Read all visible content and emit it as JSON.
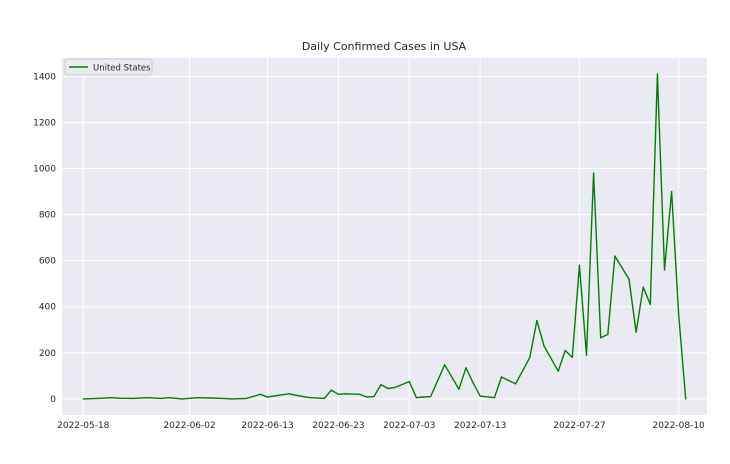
{
  "chart_data": {
    "type": "line",
    "title": "Daily Confirmed Cases in USA",
    "xlabel": "",
    "ylabel": "",
    "x_ticks": [
      "2022-05-18",
      "2022-06-02",
      "2022-06-13",
      "2022-06-23",
      "2022-07-03",
      "2022-07-13",
      "2022-07-27",
      "2022-08-10"
    ],
    "y_ticks": [
      0,
      200,
      400,
      600,
      800,
      1000,
      1200,
      1400
    ],
    "ylim": [
      -70,
      1480
    ],
    "xlim": [
      "2022-05-15",
      "2022-08-14"
    ],
    "grid": true,
    "legend": {
      "position": "top-left"
    },
    "colors": {
      "background": "#eaeaf2",
      "grid": "#ffffff",
      "line": "#008000"
    },
    "series": [
      {
        "name": "United States",
        "x": [
          "2022-05-18",
          "2022-05-20",
          "2022-05-22",
          "2022-05-23",
          "2022-05-25",
          "2022-05-27",
          "2022-05-29",
          "2022-05-30",
          "2022-06-01",
          "2022-06-03",
          "2022-06-05",
          "2022-06-06",
          "2022-06-08",
          "2022-06-10",
          "2022-06-12",
          "2022-06-13",
          "2022-06-14",
          "2022-06-16",
          "2022-06-18",
          "2022-06-19",
          "2022-06-21",
          "2022-06-22",
          "2022-06-23",
          "2022-06-24",
          "2022-06-26",
          "2022-06-27",
          "2022-06-28",
          "2022-06-29",
          "2022-06-30",
          "2022-07-01",
          "2022-07-03",
          "2022-07-04",
          "2022-07-05",
          "2022-07-06",
          "2022-07-08",
          "2022-07-10",
          "2022-07-11",
          "2022-07-12",
          "2022-07-13",
          "2022-07-15",
          "2022-07-16",
          "2022-07-18",
          "2022-07-20",
          "2022-07-21",
          "2022-07-22",
          "2022-07-24",
          "2022-07-25",
          "2022-07-26",
          "2022-07-27",
          "2022-07-28",
          "2022-07-29",
          "2022-07-30",
          "2022-07-31",
          "2022-08-01",
          "2022-08-03",
          "2022-08-04",
          "2022-08-05",
          "2022-08-06",
          "2022-08-07",
          "2022-08-08",
          "2022-08-09",
          "2022-08-10",
          "2022-08-11"
        ],
        "values": [
          0,
          2,
          5,
          3,
          2,
          5,
          2,
          5,
          0,
          5,
          4,
          3,
          0,
          2,
          20,
          8,
          13,
          22,
          10,
          5,
          2,
          38,
          20,
          22,
          20,
          8,
          10,
          62,
          45,
          50,
          75,
          5,
          8,
          10,
          148,
          42,
          135,
          70,
          12,
          5,
          95,
          65,
          180,
          340,
          230,
          120,
          210,
          180,
          580,
          190,
          980,
          265,
          280,
          620,
          520,
          290,
          485,
          410,
          1410,
          560,
          900,
          370,
          0
        ]
      }
    ]
  }
}
